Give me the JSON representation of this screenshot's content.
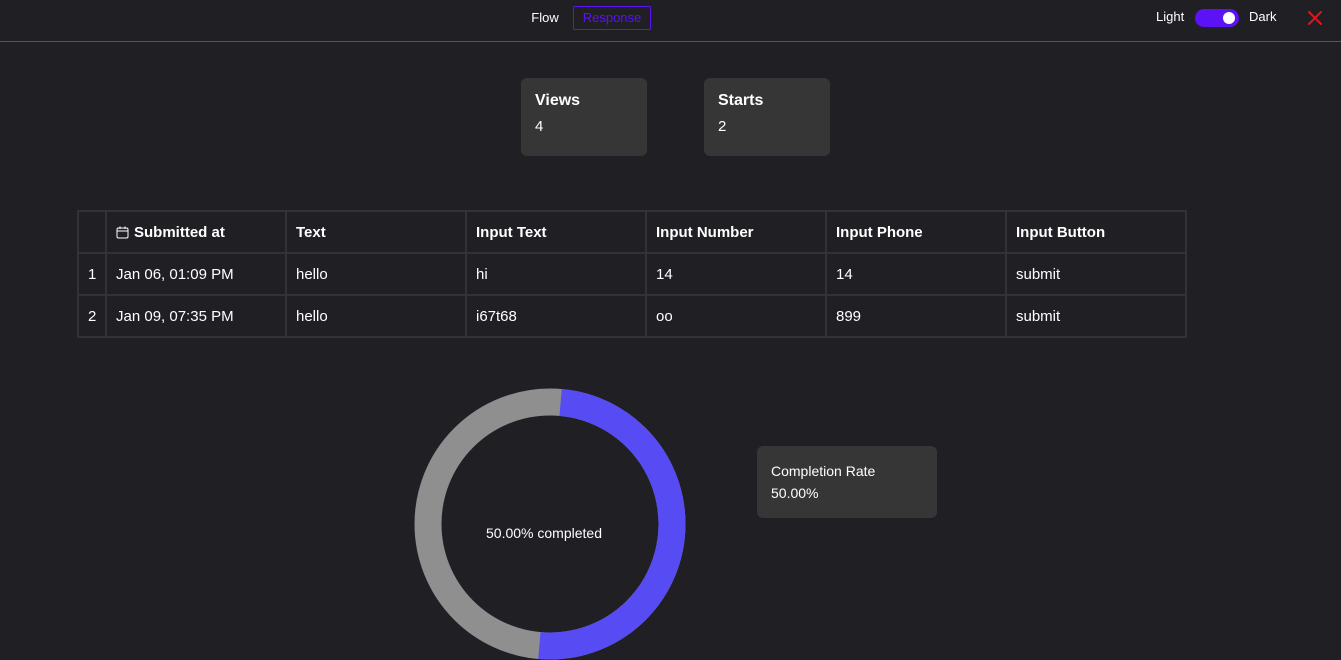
{
  "header": {
    "tabs": [
      "Flow",
      "Response"
    ],
    "theme": {
      "light_label": "Light",
      "dark_label": "Dark",
      "dark_enabled": true
    },
    "close_icon": "close-x-icon",
    "accent_color": "#5b12f5",
    "close_color": "#e0161b"
  },
  "stats": [
    {
      "label": "Views",
      "value": "4"
    },
    {
      "label": "Starts",
      "value": "2"
    }
  ],
  "table": {
    "header_icon": "calendar-icon",
    "columns": [
      "",
      "Submitted at",
      "Text",
      "Input Text",
      "Input Number",
      "Input Phone",
      "Input Button"
    ],
    "rows": [
      [
        "1",
        "Jan 06, 01:09 PM",
        "hello",
        "hi",
        "14",
        "14",
        "submit"
      ],
      [
        "2",
        "Jan 09, 07:35 PM",
        "hello",
        "i67t68",
        "oo",
        "899",
        "submit"
      ]
    ]
  },
  "completion": {
    "label": "50.00% completed",
    "fraction": 0.5,
    "fill_color": "#574bf4",
    "track_color": "#8f8f8f",
    "card_title": "Completion Rate",
    "card_value": "50.00%"
  }
}
